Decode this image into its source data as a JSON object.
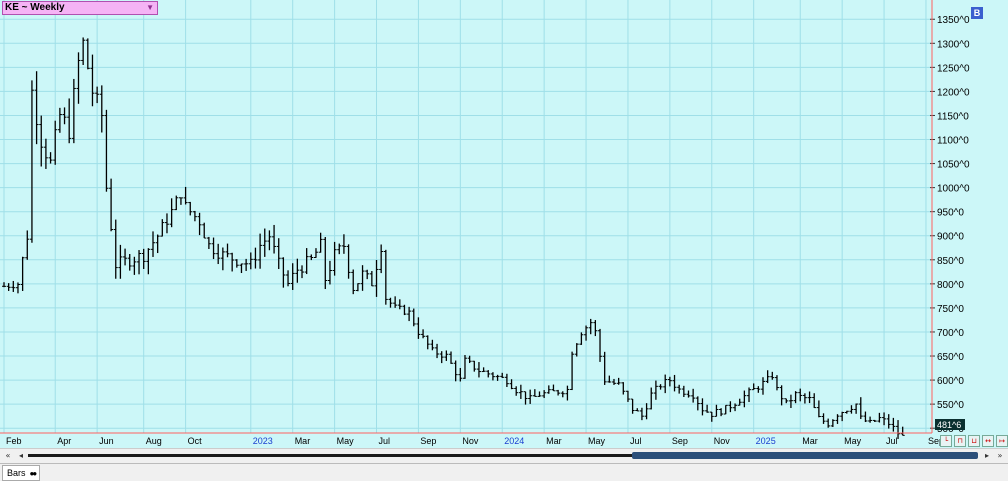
{
  "symbol_box": {
    "label": "KE ~ Weekly",
    "dropdown_icon": "triangle-down-icon"
  },
  "corner_badge": {
    "label": "B"
  },
  "price_marker": {
    "label": "481^6"
  },
  "chart_data": {
    "type": "ohlc",
    "title": "KE ~ Weekly",
    "y_axis": {
      "min": 490,
      "max": 1390,
      "tick_values": [
        500,
        550,
        600,
        650,
        700,
        750,
        800,
        850,
        900,
        950,
        1000,
        1050,
        1100,
        1150,
        1200,
        1250,
        1300,
        1350
      ],
      "tick_labels": [
        "500^0",
        "550^0",
        "600^0",
        "650^0",
        "700^0",
        "750^0",
        "800^0",
        "850^0",
        "900^0",
        "950^0",
        "1000^0",
        "1050^0",
        "1100^0",
        "1150^0",
        "1200^0",
        "1250^0",
        "1300^0",
        "1350^0"
      ]
    },
    "x_axis": {
      "labels": [
        {
          "text": "Feb",
          "week": 0,
          "year_marker": false
        },
        {
          "text": "Apr",
          "week": 11,
          "year_marker": false
        },
        {
          "text": "Jun",
          "week": 20,
          "year_marker": false
        },
        {
          "text": "Aug",
          "week": 30,
          "year_marker": false
        },
        {
          "text": "Oct",
          "week": 39,
          "year_marker": false
        },
        {
          "text": "2023",
          "week": 53,
          "year_marker": true
        },
        {
          "text": "Mar",
          "week": 62,
          "year_marker": false
        },
        {
          "text": "May",
          "week": 71,
          "year_marker": false
        },
        {
          "text": "Jul",
          "week": 80,
          "year_marker": false
        },
        {
          "text": "Sep",
          "week": 89,
          "year_marker": false
        },
        {
          "text": "Nov",
          "week": 98,
          "year_marker": false
        },
        {
          "text": "2024",
          "week": 107,
          "year_marker": true
        },
        {
          "text": "Mar",
          "week": 116,
          "year_marker": false
        },
        {
          "text": "May",
          "week": 125,
          "year_marker": false
        },
        {
          "text": "Jul",
          "week": 134,
          "year_marker": false
        },
        {
          "text": "Sep",
          "week": 143,
          "year_marker": false
        },
        {
          "text": "Nov",
          "week": 152,
          "year_marker": false
        },
        {
          "text": "2025",
          "week": 161,
          "year_marker": true
        },
        {
          "text": "Mar",
          "week": 171,
          "year_marker": false
        },
        {
          "text": "May",
          "week": 180,
          "year_marker": false
        },
        {
          "text": "Jul",
          "week": 189,
          "year_marker": false
        },
        {
          "text": "Sep",
          "week": 198,
          "year_marker": false
        }
      ]
    },
    "anchor_closes": [
      [
        0,
        795
      ],
      [
        3,
        800
      ],
      [
        5,
        900
      ],
      [
        6,
        1200
      ],
      [
        8,
        1100
      ],
      [
        10,
        1050
      ],
      [
        12,
        1150
      ],
      [
        14,
        1120
      ],
      [
        16,
        1260
      ],
      [
        17,
        1300
      ],
      [
        19,
        1200
      ],
      [
        21,
        1150
      ],
      [
        22,
        1000
      ],
      [
        24,
        840
      ],
      [
        27,
        850
      ],
      [
        30,
        860
      ],
      [
        33,
        900
      ],
      [
        36,
        950
      ],
      [
        38,
        990
      ],
      [
        39,
        960
      ],
      [
        42,
        930
      ],
      [
        44,
        880
      ],
      [
        47,
        860
      ],
      [
        50,
        850
      ],
      [
        53,
        840
      ],
      [
        55,
        880
      ],
      [
        57,
        900
      ],
      [
        59,
        840
      ],
      [
        61,
        800
      ],
      [
        63,
        830
      ],
      [
        66,
        850
      ],
      [
        68,
        880
      ],
      [
        69,
        810
      ],
      [
        71,
        860
      ],
      [
        73,
        880
      ],
      [
        75,
        790
      ],
      [
        77,
        820
      ],
      [
        79,
        800
      ],
      [
        81,
        880
      ],
      [
        82,
        770
      ],
      [
        84,
        750
      ],
      [
        87,
        740
      ],
      [
        89,
        700
      ],
      [
        92,
        660
      ],
      [
        95,
        650
      ],
      [
        98,
        600
      ],
      [
        99,
        640
      ],
      [
        102,
        620
      ],
      [
        105,
        610
      ],
      [
        108,
        600
      ],
      [
        110,
        580
      ],
      [
        113,
        560
      ],
      [
        115,
        570
      ],
      [
        118,
        575
      ],
      [
        121,
        580
      ],
      [
        122,
        660
      ],
      [
        124,
        700
      ],
      [
        126,
        720
      ],
      [
        127,
        700
      ],
      [
        129,
        600
      ],
      [
        132,
        590
      ],
      [
        135,
        540
      ],
      [
        137,
        525
      ],
      [
        139,
        570
      ],
      [
        141,
        590
      ],
      [
        143,
        600
      ],
      [
        145,
        580
      ],
      [
        148,
        570
      ],
      [
        150,
        540
      ],
      [
        152,
        530
      ],
      [
        155,
        540
      ],
      [
        158,
        560
      ],
      [
        161,
        580
      ],
      [
        164,
        600
      ],
      [
        165,
        610
      ],
      [
        166,
        580
      ],
      [
        168,
        550
      ],
      [
        170,
        570
      ],
      [
        171,
        565
      ],
      [
        173,
        560
      ],
      [
        175,
        520
      ],
      [
        177,
        510
      ],
      [
        179,
        530
      ],
      [
        181,
        540
      ],
      [
        183,
        550
      ],
      [
        184,
        520
      ],
      [
        186,
        510
      ],
      [
        188,
        520
      ],
      [
        190,
        510
      ],
      [
        191,
        500
      ],
      [
        192,
        490
      ],
      [
        193,
        482
      ]
    ],
    "last_value": "481^6",
    "grid": true,
    "background": "#ccf7f8",
    "grid_color": "#9fdfe8",
    "bar_color": "#000000"
  },
  "bottom_bar": {
    "study_label": "Bars",
    "study_icon": "double-circle-icon"
  },
  "scrollbar": {
    "left_icon": "double-left-icon",
    "right_icon": "double-right-icon"
  },
  "nav_buttons": [
    "zoom-first-icon",
    "zoom-in-icon",
    "zoom-out-icon",
    "scroll-left-icon",
    "scroll-right-icon"
  ]
}
